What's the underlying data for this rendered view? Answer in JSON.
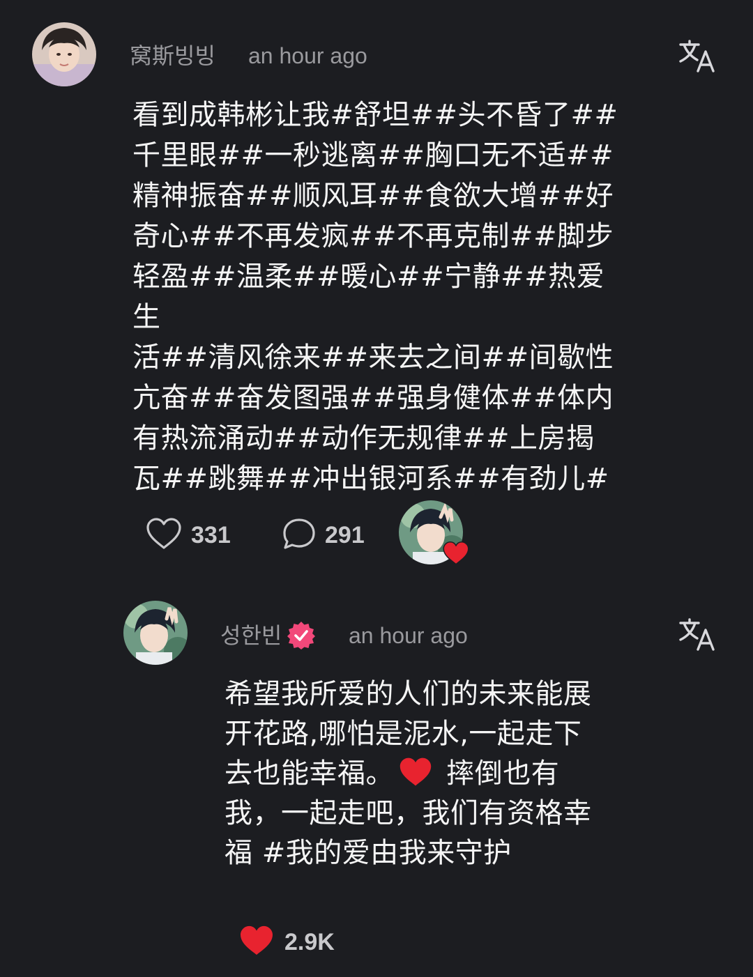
{
  "comments": [
    {
      "username": "窝斯빙빙",
      "time": "an hour ago",
      "text": "看到成韩彬让我#舒坦##头不昏了##\n千里眼##一秒逃离##胸口无不适##\n精神振奋##顺风耳##食欲大增##好\n奇心##不再发疯##不再克制##脚步\n轻盈##温柔##暖心##宁静##热爱生\n活##清风徐来##来去之间##间歇性\n亢奋##奋发图强##强身健体##体内\n有热流涌动##动作无规律##上房揭\n瓦##跳舞##冲出银河系##有劲儿#",
      "likes": "331",
      "replies": "291"
    },
    {
      "username": "성한빈",
      "verified": true,
      "time": "an hour ago",
      "text_part1": "希望我所爱的人们的未来能展\n开花路,哪怕是泥水,一起走下\n去也能幸福。",
      "text_part2": " 摔倒也有\n我，一起走吧，我们有资格幸\n福 #我的爱由我来守护",
      "likes": "2.9K",
      "liked": true
    }
  ],
  "icons": {
    "translate": "translate-icon",
    "like": "heart-outline-icon",
    "reply": "speech-bubble-icon",
    "liked": "heart-filled-icon",
    "verified": "verified-badge-icon"
  },
  "colors": {
    "background": "#1c1d21",
    "text": "#f5f5f5",
    "muted": "#9a9a9e",
    "heart_red": "#e8232f",
    "verified_pink": "#f2487a"
  }
}
